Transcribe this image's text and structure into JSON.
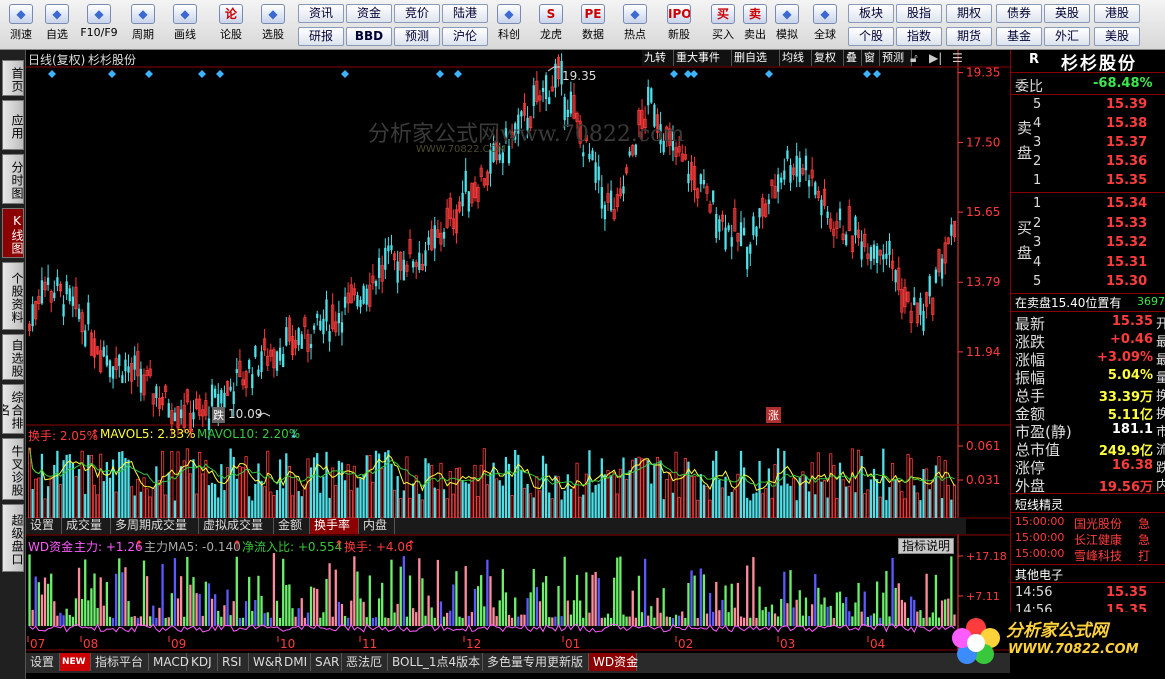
{
  "toolbar": {
    "items": [
      {
        "label": "测速",
        "icon": "speed-icon"
      },
      {
        "label": "自选",
        "icon": "star-icon"
      },
      {
        "label": "F10/F9",
        "icon": "info-icon"
      },
      {
        "label": "周期",
        "icon": "clock-icon"
      },
      {
        "label": "画线",
        "icon": "pen-icon"
      },
      {
        "label": "论股",
        "icon": "discuss-icon",
        "glyph": "论"
      },
      {
        "label": "选股",
        "icon": "select-icon"
      },
      {
        "label": "科创",
        "icon": "chart-icon"
      },
      {
        "label": "龙虎",
        "icon": "dragon-icon",
        "glyph": "S"
      },
      {
        "label": "数据",
        "icon": "data-icon",
        "glyph": "PE"
      },
      {
        "label": "热点",
        "icon": "fire-icon"
      },
      {
        "label": "新股",
        "icon": "ipo-icon",
        "glyph": "IPO"
      },
      {
        "label": "买入",
        "icon": "buy-icon",
        "glyph": "买"
      },
      {
        "label": "卖出",
        "icon": "sell-icon",
        "glyph": "卖"
      },
      {
        "label": "模拟",
        "icon": "hammer-icon"
      },
      {
        "label": "全球",
        "icon": "globe-icon"
      }
    ],
    "buttons_row1": [
      "资讯",
      "资金",
      "竞价",
      "陆港"
    ],
    "buttons_row2": [
      "研报",
      "BBD",
      "预测",
      "沪伦"
    ],
    "buttons_right1": [
      "板块",
      "股指",
      "期权",
      "债券",
      "英股",
      "港股"
    ],
    "buttons_right2": [
      "个股",
      "指数",
      "期货",
      "基金",
      "外汇",
      "美股"
    ]
  },
  "leftnav": [
    {
      "label": "首页",
      "active": false
    },
    {
      "label": "应用",
      "active": false
    },
    {
      "label": "分时图",
      "active": false
    },
    {
      "label": "K线图",
      "active": true
    },
    {
      "label": "个股资料",
      "active": false
    },
    {
      "label": "自选股",
      "active": false
    },
    {
      "label": "综合排名",
      "active": false
    },
    {
      "label": "牛叉诊股",
      "active": false
    },
    {
      "label": "超级盘口",
      "active": false
    }
  ],
  "chart": {
    "header_left": "日线(复权)",
    "stock_name": "杉杉股份",
    "header_tabs": [
      "九转",
      "重大事件",
      "删自选",
      "均线",
      "复权",
      "叠",
      "窗",
      "预测"
    ],
    "watermark": "分析家公式网www.70822.com",
    "watermark_sub": "WWW.70822.COM",
    "high_label": "19.35",
    "low_label": "10.09",
    "low_flag": "跌",
    "rise_flag": "涨",
    "volume_title": "换手: 2.05%",
    "volume_ma5": "MAVOL5: 2.33%",
    "volume_ma10": "MAVOL10: 2.20%",
    "sub_tabs": [
      "设置",
      "成交量",
      "多周期成交量",
      "虚拟成交量",
      "金额",
      "换手率",
      "内盘"
    ],
    "sub_active": "换手率",
    "wd_title": "WD资金",
    "wd_main": "主力: +1.26",
    "wd_ma5": "主力MA5: -0.140",
    "wd_net": "净流入比: +0.554",
    "wd_turn": "换手: +4.06",
    "wd_help": "指标说明",
    "bottom_tabs": [
      "设置",
      "NEW",
      "指标平台",
      "MACD",
      "KDJ",
      "RSI",
      "W&R",
      "DMI",
      "SAR",
      "恶法厄",
      "BOLL_1点4版本",
      "多色量专用更新版",
      "WD资金"
    ],
    "bottom_active": "WD资金",
    "colors": {
      "up": "#ff3c3c",
      "down": "#4fe0e8",
      "ma5": "#ffff3c",
      "ma10": "#39c83c",
      "axis": "#ff3c3c"
    }
  },
  "chart_data": {
    "type": "candlestick",
    "price_axis": [
      "19.35",
      "17.50",
      "15.65",
      "13.79",
      "11.94"
    ],
    "price_range": [
      10.0,
      19.5
    ],
    "turnover_axis": [
      "0.061",
      "0.031"
    ],
    "wd_axis": [
      "+17.18",
      "+7.11"
    ],
    "x_labels": [
      "07",
      "08",
      "09",
      "10",
      "11",
      "12",
      "01",
      "02",
      "03",
      "04"
    ],
    "high": 19.35,
    "low": 10.09
  },
  "quote": {
    "badge": "R",
    "name": "杉杉股份",
    "weibi_label": "委比",
    "weibi_value": "-68.48%",
    "sell_label": "卖盘",
    "buy_label": "买盘",
    "asks": [
      {
        "level": "5",
        "price": "15.39"
      },
      {
        "level": "4",
        "price": "15.38"
      },
      {
        "level": "3",
        "price": "15.37"
      },
      {
        "level": "2",
        "price": "15.36"
      },
      {
        "level": "1",
        "price": "15.35"
      }
    ],
    "bids": [
      {
        "level": "1",
        "price": "15.34"
      },
      {
        "level": "2",
        "price": "15.33"
      },
      {
        "level": "3",
        "price": "15.32"
      },
      {
        "level": "4",
        "price": "15.31"
      },
      {
        "level": "5",
        "price": "15.30"
      }
    ],
    "notice": "在卖盘15.40位置有",
    "notice_value": "3697",
    "stats": [
      {
        "label": "最新",
        "value": "15.35",
        "tail": "开",
        "color": "#ff3c3c"
      },
      {
        "label": "涨跌",
        "value": "+0.46",
        "tail": "最",
        "color": "#ff3c3c"
      },
      {
        "label": "涨幅",
        "value": "+3.09%",
        "tail": "最",
        "color": "#ff3c3c"
      },
      {
        "label": "振幅",
        "value": "5.04%",
        "tail": "量",
        "color": "#ffff3c"
      },
      {
        "label": "总手",
        "value": "33.39万",
        "tail": "换",
        "color": "#ffff3c"
      },
      {
        "label": "金额",
        "value": "5.11亿",
        "tail": "换",
        "color": "#ffff3c"
      },
      {
        "label": "市盈(静)",
        "value": "181.1",
        "tail": "市",
        "color": "#ffffff"
      },
      {
        "label": "总市值",
        "value": "249.9亿",
        "tail": "流",
        "color": "#ffff3c"
      },
      {
        "label": "涨停",
        "value": "16.38",
        "tail": "跌",
        "color": "#ff3c3c"
      },
      {
        "label": "外盘",
        "value": "19.56万",
        "tail": "内",
        "color": "#ff3c3c"
      }
    ],
    "spirit_title": "短线精灵",
    "spirit": [
      {
        "time": "15:00:00",
        "name": "国光股份",
        "action": "急"
      },
      {
        "time": "15:00:00",
        "name": "长江健康",
        "action": "急"
      },
      {
        "time": "15:00:00",
        "name": "雪峰科技",
        "action": "打"
      }
    ],
    "other_title": "其他电子",
    "other_rows": [
      {
        "time": "14:56",
        "price": "15.35"
      },
      {
        "time": "14:56",
        "price": "15.35"
      }
    ]
  },
  "logo": {
    "text": "分析家公式网",
    "url": "WWW.70822.COM"
  }
}
